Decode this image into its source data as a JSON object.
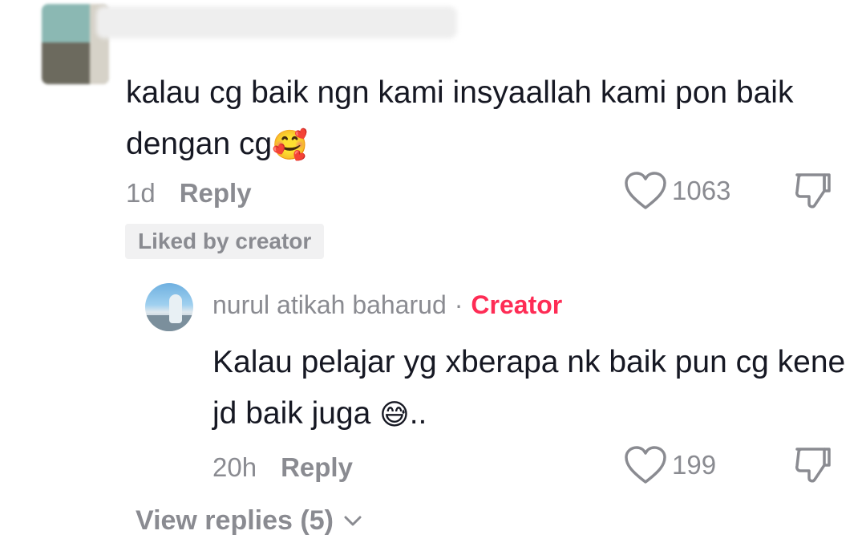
{
  "comment": {
    "text": "kalau cg baik ngn kami insyaallah kami pon baik dengan cg",
    "emoji": "🥰",
    "time": "1d",
    "reply_label": "Reply",
    "like_count": "1063",
    "badge": "Liked by creator"
  },
  "reply": {
    "author": "nurul atikah baharud",
    "separator": "·",
    "creator_tag": "Creator",
    "text": "Kalau pelajar yg xberapa nk baik pun cg kene jd baik juga",
    "emoji": "😅",
    "text_suffix": "..",
    "time": "20h",
    "reply_label": "Reply",
    "like_count": "199"
  },
  "view_replies": "View replies (5)",
  "colors": {
    "text": "#161823",
    "muted": "#8a8b91",
    "creator": "#fe2c55",
    "badge_bg": "#f1f1f2"
  },
  "icons": [
    "heart-icon",
    "thumbs-down-icon",
    "chevron-down-icon"
  ]
}
